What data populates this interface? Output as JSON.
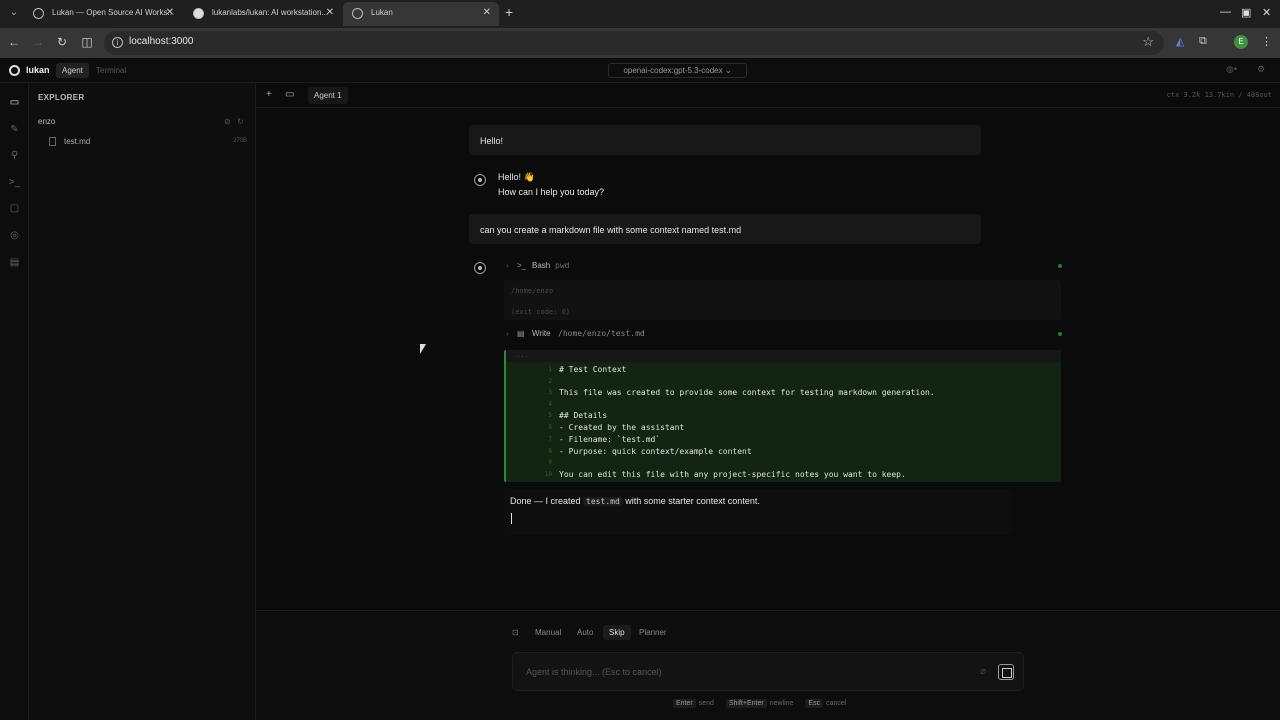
{
  "browser": {
    "tabs": [
      {
        "title": "Lukan — Open Source AI Works...",
        "active": false
      },
      {
        "title": "lukanlabs/lukan: AI workstation...",
        "active": false
      },
      {
        "title": "Lukan",
        "active": true
      }
    ],
    "url": "localhost:3000",
    "profile_initial": "E"
  },
  "app": {
    "logo": "lukan",
    "modes": [
      "Agent",
      "Terminal"
    ],
    "model": "openai-codex:gpt-5.3-codex ⌄"
  },
  "explorer": {
    "title": "EXPLORER",
    "folder": "enzo",
    "files": [
      {
        "name": "test.md",
        "size": "270B"
      }
    ]
  },
  "main": {
    "new_tab_icon": "+",
    "agent_tab": "Agent 1",
    "ctx": "ctx 3.2k  13.7kin / 488out"
  },
  "chat": {
    "user1": "Hello!",
    "assistant1_line1": "Hello! 👋",
    "assistant1_line2": "How can I help you today?",
    "user2": "can you create a markdown file with some context named test.md",
    "tool1": {
      "name": "Bash",
      "arg": "pwd",
      "output1": "/home/enzo",
      "output2": "(exit code: 0)"
    },
    "tool2": {
      "name": "Write",
      "arg": "/home/enzo/test.md"
    },
    "code_head": "...",
    "code": [
      {
        "n": "1",
        "t": "# Test Context"
      },
      {
        "n": "2",
        "t": ""
      },
      {
        "n": "3",
        "t": "This file was created to provide some context for testing markdown generation."
      },
      {
        "n": "4",
        "t": ""
      },
      {
        "n": "5",
        "t": "## Details"
      },
      {
        "n": "6",
        "t": "- Created by the assistant"
      },
      {
        "n": "7",
        "t": "- Filename: `test.md`"
      },
      {
        "n": "8",
        "t": "- Purpose: quick context/example content"
      },
      {
        "n": "9",
        "t": ""
      },
      {
        "n": "10",
        "t": "You can edit this file with any project-specific notes you want to keep."
      }
    ],
    "done_pre": "Done — I created ",
    "done_code": "test.md",
    "done_post": " with some starter context content."
  },
  "input": {
    "modes": [
      "Manual",
      "Auto",
      "Skip",
      "Planner"
    ],
    "active_mode": "Skip",
    "placeholder": "Agent is thinking... (Esc to cancel)",
    "hints": [
      {
        "key": "Enter",
        "label": "send"
      },
      {
        "key": "Shift+Enter",
        "label": "newline"
      },
      {
        "key": "Esc",
        "label": "cancel"
      }
    ]
  }
}
